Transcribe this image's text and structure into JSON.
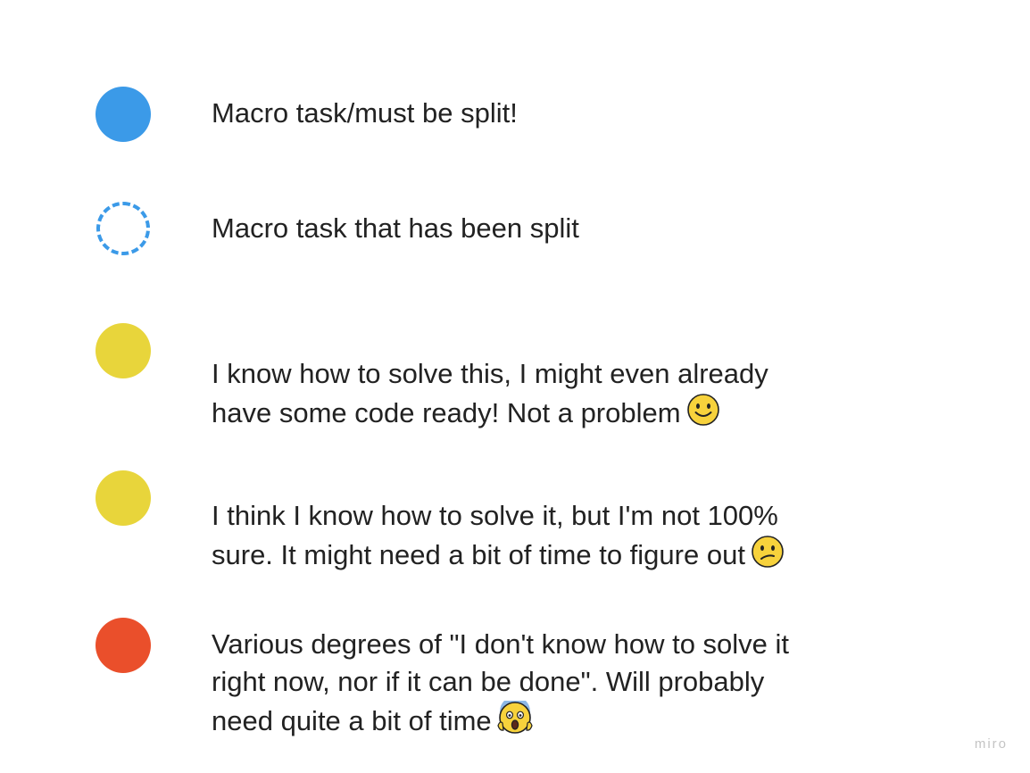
{
  "legend": [
    {
      "shape": "filled-circle",
      "color": "#3b9ae8",
      "text": "Macro task/must be split!",
      "emoji": ""
    },
    {
      "shape": "dashed-circle",
      "color": "#3b9ae8",
      "text": "Macro task that has been split",
      "emoji": ""
    },
    {
      "shape": "filled-circle",
      "color": "#e8d53b",
      "text": "I know how to solve this, I might even already\nhave some code ready! Not a problem",
      "emoji": "slightly-smiling-face-icon"
    },
    {
      "shape": "filled-circle",
      "color": "#e8d53b",
      "text": "I think I know how to solve it, but I'm not 100%\nsure. It might need a bit of time to figure out",
      "emoji": "confused-face-icon"
    },
    {
      "shape": "filled-circle",
      "color": "#ea4f2b",
      "text": "Various degrees of \"I don't know how to solve it\nright now, nor if it can be done\". Will probably\nneed quite a bit of time",
      "emoji": "screaming-face-icon"
    }
  ],
  "watermark": "miro"
}
